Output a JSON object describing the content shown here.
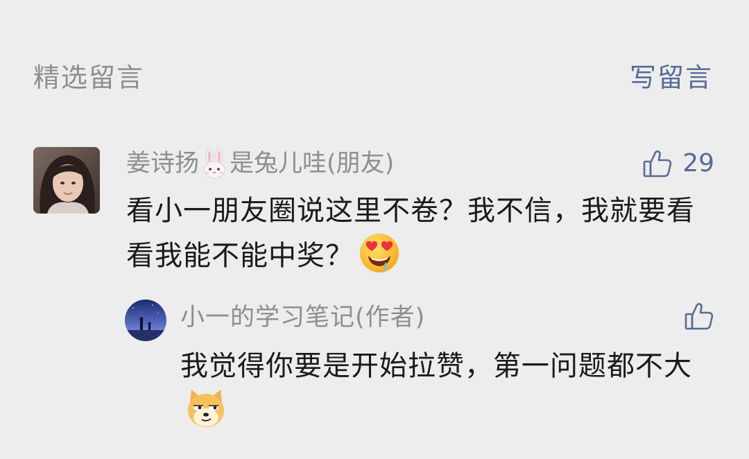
{
  "header": {
    "title": "精选留言",
    "write_label": "写留言"
  },
  "comment": {
    "nickname_before_emoji": "姜诗扬",
    "nickname_emoji": "rabbit-face-emoji",
    "nickname_after_emoji": "是兔儿哇(朋友)",
    "like_icon": "thumbs-up-icon",
    "like_count": "29",
    "content": "看小一朋友圈说这里不卷？我不信，我就要看看我能不能中奖？",
    "content_emoji": "heart-eyes-drooling-emoji"
  },
  "reply": {
    "nickname": "小一的学习笔记(作者)",
    "like_icon": "thumbs-up-icon",
    "content": "我觉得你要是开始拉赞，第一问题都不大",
    "content_emoji": "smug-doge-emoji"
  },
  "colors": {
    "background": "#ededed",
    "link_blue": "#576b95",
    "meta_gray": "#8e8e8e",
    "text": "#1a1a1a"
  }
}
